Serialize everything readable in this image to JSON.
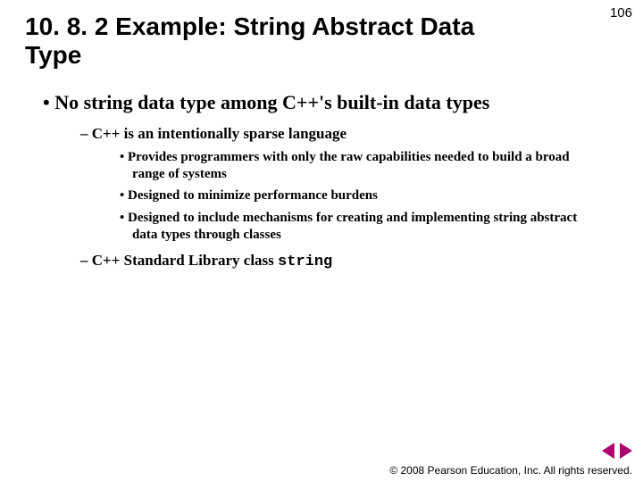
{
  "page_number": "106",
  "title": "10. 8. 2 Example: String Abstract Data Type",
  "bullets": {
    "l1_0": "No string data type among C++'s built-in data types",
    "l2_0": "C++ is an intentionally sparse language",
    "l3_0": "Provides programmers with only the raw capabilities needed to build a broad range of systems",
    "l3_1": "Designed to minimize performance burdens",
    "l3_2": "Designed to include mechanisms for creating and implementing string abstract data types through classes",
    "l2_1_prefix": "C++ Standard Library class ",
    "l2_1_code": "string"
  },
  "copyright": "© 2008 Pearson Education, Inc.  All rights reserved."
}
